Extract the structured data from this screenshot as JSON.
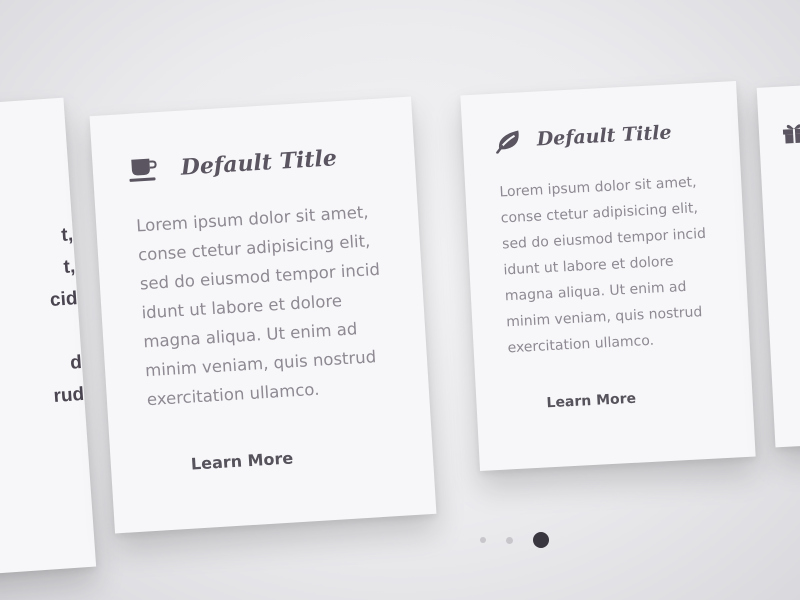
{
  "left_card": {
    "partial_lines": [
      "t,",
      "t,",
      "cid",
      "",
      "d",
      "rud"
    ]
  },
  "cards": [
    {
      "icon": "coffee-cup-icon",
      "title": "Default Title",
      "body": "Lorem ipsum dolor sit amet,\nconse ctetur adipisicing elit,\nsed do eiusmod tempor incid\nidunt ut labore et dolore\nmagna aliqua. Ut enim ad\nminim veniam, quis nostrud\nexercitation ullamco.",
      "link": "Learn More"
    },
    {
      "icon": "leaf-icon",
      "title": "Default Title",
      "body": "Lorem ipsum dolor sit amet,\nconse ctetur adipisicing elit,\nsed do eiusmod tempor incid\nidunt ut labore et dolore\nmagna aliqua. Ut enim ad\nminim veniam, quis nostrud\nexercitation ullamco.",
      "link": "Learn More"
    }
  ],
  "right_card": {
    "icon": "gift-icon"
  },
  "pagination": {
    "total": 3,
    "active_index": 2
  },
  "colors": {
    "title": "#5a5560",
    "body_text": "#8e8992",
    "link": "#57535c",
    "card_background": "#f7f7f9",
    "dot_active": "#3a363f",
    "dot_inactive": "#c8c6cb"
  }
}
